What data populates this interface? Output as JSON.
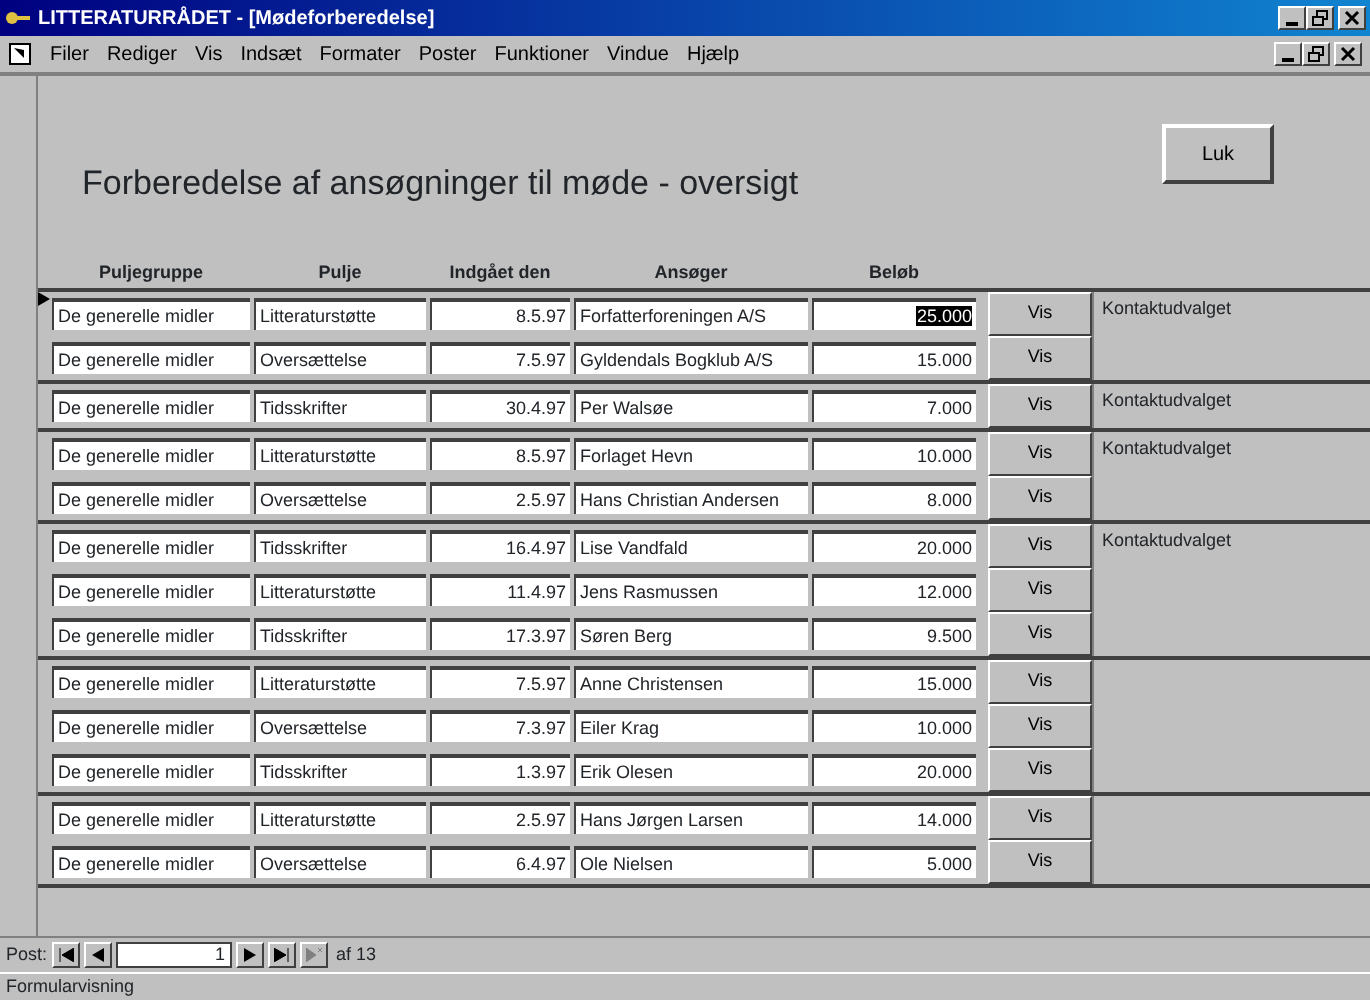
{
  "window": {
    "title": "LITTERATURRÅDET - [Mødeforberedelse]"
  },
  "menu": [
    "Filer",
    "Rediger",
    "Vis",
    "Indsæt",
    "Formater",
    "Poster",
    "Funktioner",
    "Vindue",
    "Hjælp"
  ],
  "form": {
    "heading": "Forberedelse af ansøgninger til møde - oversigt",
    "close_button": "Luk",
    "columns": [
      "Puljegruppe",
      "Pulje",
      "Indgået den",
      "Ansøger",
      "Beløb"
    ],
    "records": [
      {
        "note": "Kontaktudvalget",
        "rows": [
          {
            "cells": [
              "De generelle midler",
              "Litteraturstøtte",
              "8.5.97",
              "Forfatterforeningen A/S",
              "25.000"
            ],
            "button": "Vis",
            "selected": true
          },
          {
            "cells": [
              "De generelle midler",
              "Oversættelse",
              "7.5.97",
              "Gyldendals Bogklub A/S",
              "15.000"
            ],
            "button": "Vis",
            "selected": false
          }
        ]
      },
      {
        "note": "Kontaktudvalget",
        "rows": [
          {
            "cells": [
              "De generelle midler",
              "Tidsskrifter",
              "30.4.97",
              "Per Walsøe",
              "7.000"
            ],
            "button": "Vis",
            "selected": false
          }
        ]
      },
      {
        "note": "Kontaktudvalget",
        "rows": [
          {
            "cells": [
              "De generelle midler",
              "Litteraturstøtte",
              "8.5.97",
              "Forlaget Hevn",
              "10.000"
            ],
            "button": "Vis",
            "selected": false
          },
          {
            "cells": [
              "De generelle midler",
              "Oversættelse",
              "2.5.97",
              "Hans Christian Andersen",
              "8.000"
            ],
            "button": "Vis",
            "selected": false
          }
        ]
      },
      {
        "note": "Kontaktudvalget",
        "rows": [
          {
            "cells": [
              "De generelle midler",
              "Tidsskrifter",
              "16.4.97",
              "Lise Vandfald",
              "20.000"
            ],
            "button": "Vis",
            "selected": false
          },
          {
            "cells": [
              "De generelle midler",
              "Litteraturstøtte",
              "11.4.97",
              "Jens Rasmussen",
              "12.000"
            ],
            "button": "Vis",
            "selected": false
          },
          {
            "cells": [
              "De generelle midler",
              "Tidsskrifter",
              "17.3.97",
              "Søren Berg",
              "9.500"
            ],
            "button": "Vis",
            "selected": false
          }
        ]
      },
      {
        "rows": [
          {
            "cells": [
              "De generelle midler",
              "Litteraturstøtte",
              "7.5.97",
              "Anne Christensen",
              "15.000"
            ],
            "button": "Vis",
            "selected": false
          },
          {
            "cells": [
              "De generelle midler",
              "Oversættelse",
              "7.3.97",
              "Eiler Krag",
              "10.000"
            ],
            "button": "Vis",
            "selected": false
          },
          {
            "cells": [
              "De generelle midler",
              "Tidsskrifter",
              "1.3.97",
              "Erik Olesen",
              "20.000"
            ],
            "button": "Vis",
            "selected": false
          }
        ]
      },
      {
        "rows": [
          {
            "cells": [
              "De generelle midler",
              "Litteraturstøtte",
              "2.5.97",
              "Hans Jørgen Larsen",
              "14.000"
            ],
            "button": "Vis",
            "selected": false
          },
          {
            "cells": [
              "De generelle midler",
              "Oversættelse",
              "6.4.97",
              "Ole Nielsen",
              "5.000"
            ],
            "button": "Vis",
            "selected": false
          }
        ]
      }
    ]
  },
  "navigator": {
    "label": "Post:",
    "current": "1",
    "total": "af 13"
  },
  "status_bar": {
    "text": "Formularvisning"
  }
}
